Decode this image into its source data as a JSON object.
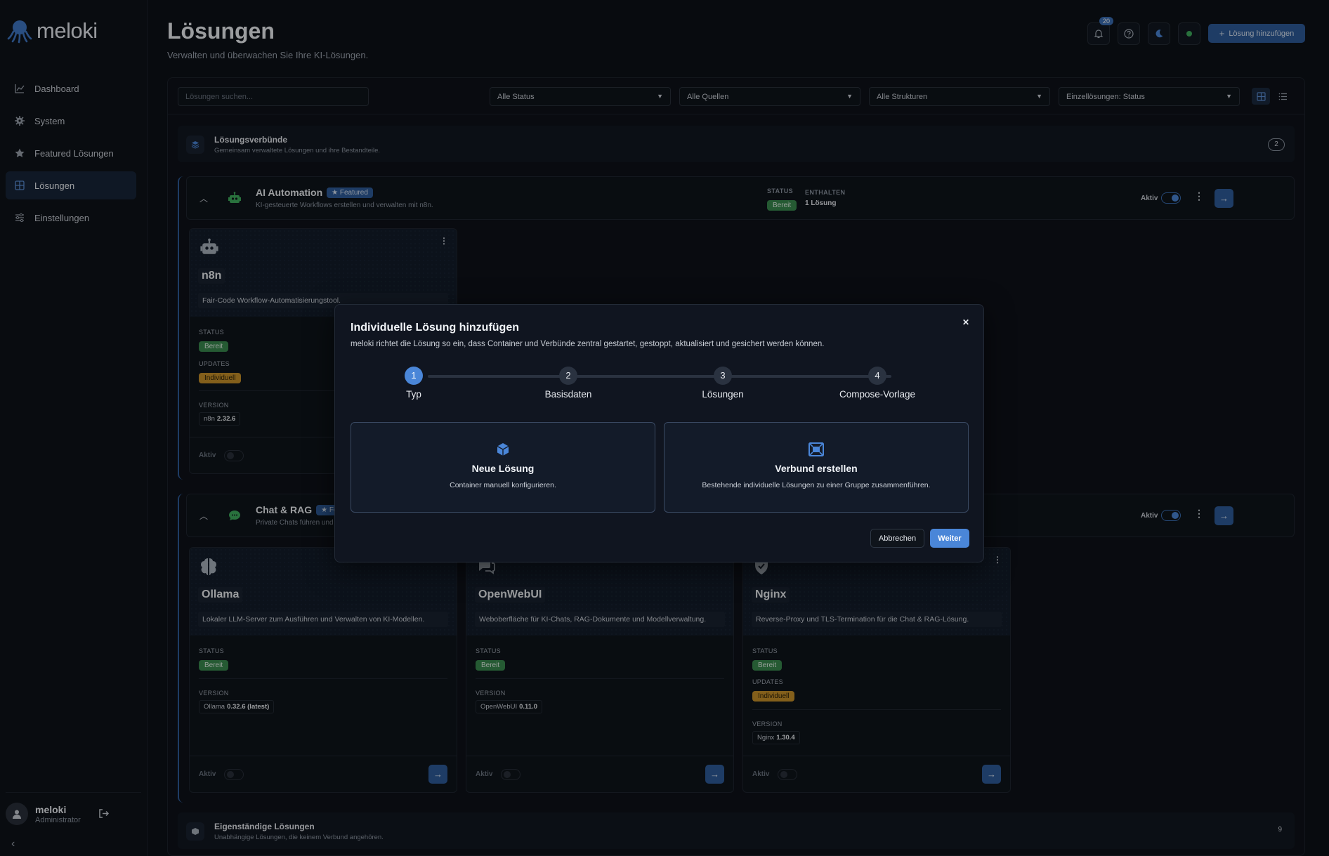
{
  "app": {
    "name": "meloki"
  },
  "sidebar": {
    "items": [
      {
        "label": "Dashboard",
        "icon": "chart-icon"
      },
      {
        "label": "System",
        "icon": "gear-icon"
      },
      {
        "label": "Featured Lösungen",
        "icon": "star-icon"
      },
      {
        "label": "Lösungen",
        "icon": "grid-icon",
        "active": true
      },
      {
        "label": "Einstellungen",
        "icon": "sliders-icon"
      }
    ],
    "user": {
      "name": "meloki",
      "role": "Administrator"
    }
  },
  "header": {
    "title": "Lösungen",
    "subtitle": "Verwalten und überwachen Sie Ihre KI-Lösungen.",
    "notifications_count": "20",
    "add_label": "Lösung hinzufügen"
  },
  "filters": {
    "search_placeholder": "Lösungen suchen...",
    "status": "Alle Status",
    "sources": "Alle Quellen",
    "structures": "Alle Strukturen",
    "single": "Einzellösungen: Status"
  },
  "sections": {
    "compounds": {
      "title": "Lösungsverbünde",
      "subtitle": "Gemeinsam verwaltete Lösungen und ihre Bestandteile.",
      "count": "2"
    },
    "standalone": {
      "title": "Eigenständige Lösungen",
      "subtitle": "Unabhängige Lösungen, die keinem Verbund angehören.",
      "count": "9"
    }
  },
  "labels": {
    "status": "STATUS",
    "contained": "ENTHALTEN",
    "aktiv": "Aktiv",
    "card_status": "STATUS",
    "card_updates": "UPDATES",
    "card_version": "VERSION",
    "ready": "Bereit",
    "individual": "Individuell",
    "featured": "Featured"
  },
  "groups": [
    {
      "title": "AI Automation",
      "featured": true,
      "subtitle": "KI-gesteuerte Workflows erstellen und verwalten mit n8n.",
      "status": "Bereit",
      "contained": "1 Lösung",
      "cards": [
        {
          "name": "n8n",
          "desc": "Fair-Code Workflow-Automatisierungstool.",
          "status": "Bereit",
          "updates": "Individuell",
          "ver_name": "n8n",
          "ver": "2.32.6"
        }
      ]
    },
    {
      "title": "Chat & RAG",
      "featured": true,
      "subtitle": "Private Chats führen und",
      "cards": [
        {
          "name": "Ollama",
          "desc": "Lokaler LLM-Server zum Ausführen und Verwalten von KI-Modellen.",
          "status": "Bereit",
          "ver_name": "Ollama",
          "ver": "0.32.6 (latest)"
        },
        {
          "name": "OpenWebUI",
          "desc": "Weboberfläche für KI-Chats, RAG-Dokumente und Modellverwaltung.",
          "status": "Bereit",
          "ver_name": "OpenWebUI",
          "ver": "0.11.0"
        },
        {
          "name": "Nginx",
          "desc": "Reverse-Proxy und TLS-Termination für die Chat & RAG-Lösung.",
          "status": "Bereit",
          "updates": "Individuell",
          "ver_name": "Nginx",
          "ver": "1.30.4"
        }
      ]
    }
  ],
  "modal": {
    "title": "Individuelle Lösung hinzufügen",
    "subtitle": "meloki richtet die Lösung so ein, dass Container und Verbünde zentral gestartet, gestoppt, aktualisiert und gesichert werden können.",
    "steps": [
      {
        "num": "1",
        "label": "Typ"
      },
      {
        "num": "2",
        "label": "Basisdaten"
      },
      {
        "num": "3",
        "label": "Lösungen"
      },
      {
        "num": "4",
        "label": "Compose-Vorlage"
      }
    ],
    "choices": [
      {
        "title": "Neue Lösung",
        "subtitle": "Container manuell konfigurieren."
      },
      {
        "title": "Verbund erstellen",
        "subtitle": "Bestehende individuelle Lösungen zu einer Gruppe zusammenführen."
      }
    ],
    "cancel": "Abbrechen",
    "next": "Weiter"
  }
}
